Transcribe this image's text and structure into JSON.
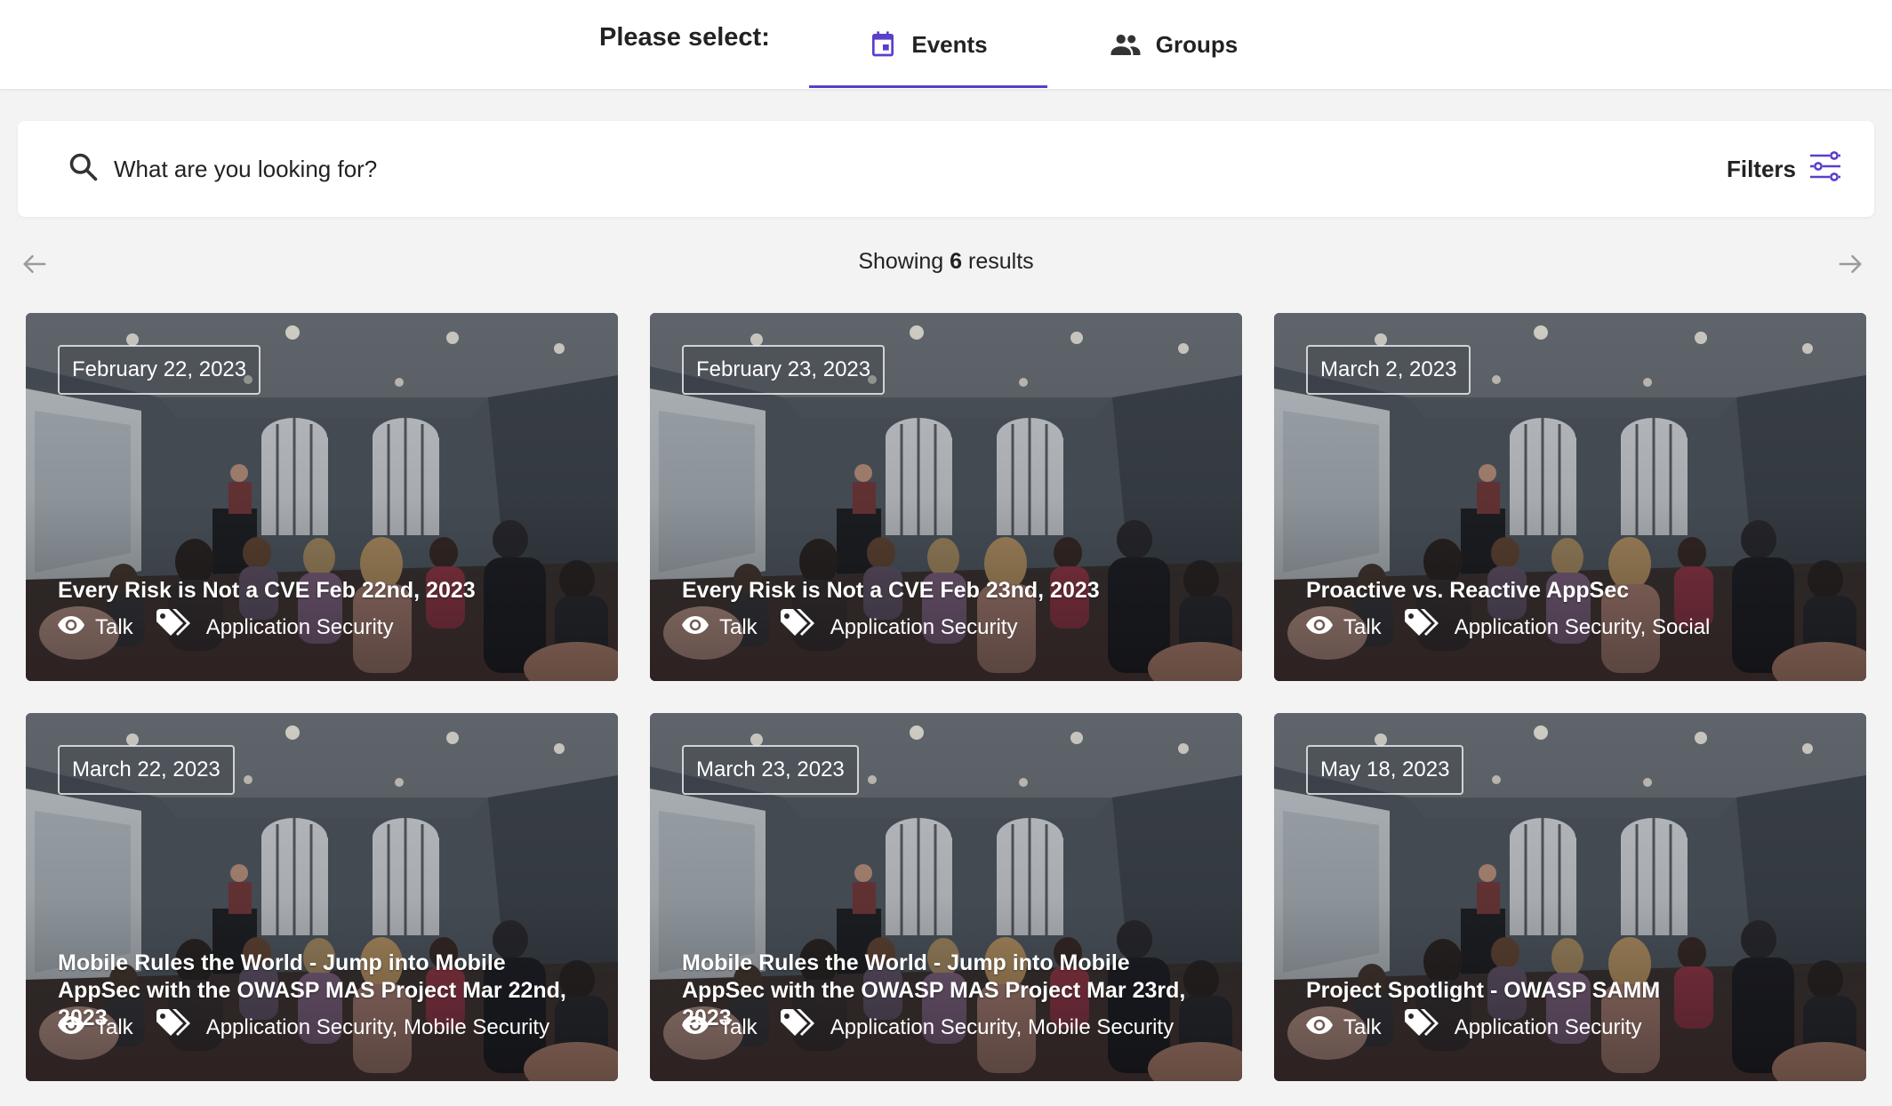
{
  "header": {
    "select_label": "Please select:",
    "tabs": [
      {
        "label": "Events",
        "icon": "calendar-icon",
        "active": true
      },
      {
        "label": "Groups",
        "icon": "people-icon",
        "active": false
      }
    ]
  },
  "search": {
    "placeholder": "What are you looking for?",
    "filters_label": "Filters"
  },
  "results": {
    "prefix": "Showing",
    "count": "6",
    "suffix": "results"
  },
  "colors": {
    "accent": "#5b3ecb",
    "background": "#f3f3f4"
  },
  "cards": [
    {
      "date": "February 22, 2023",
      "title": "Every Risk is Not a CVE Feb 22nd, 2023",
      "type": "Talk",
      "tags": "Application Security"
    },
    {
      "date": "February 23, 2023",
      "title": "Every Risk is Not a CVE Feb 23nd, 2023",
      "type": "Talk",
      "tags": "Application Security"
    },
    {
      "date": "March 2, 2023",
      "title": "Proactive vs. Reactive AppSec",
      "type": "Talk",
      "tags": "Application Security, Social"
    },
    {
      "date": "March 22, 2023",
      "title": "Mobile Rules the World - Jump into Mobile AppSec with the OWASP MAS Project Mar 22nd, 2023",
      "type": "Talk",
      "tags": "Application Security, Mobile Security"
    },
    {
      "date": "March 23, 2023",
      "title": "Mobile Rules the World - Jump into Mobile AppSec with the OWASP MAS Project Mar 23rd, 2023",
      "type": "Talk",
      "tags": "Application Security, Mobile Security"
    },
    {
      "date": "May 18, 2023",
      "title": "Project Spotlight - OWASP SAMM",
      "type": "Talk",
      "tags": "Application Security"
    }
  ]
}
